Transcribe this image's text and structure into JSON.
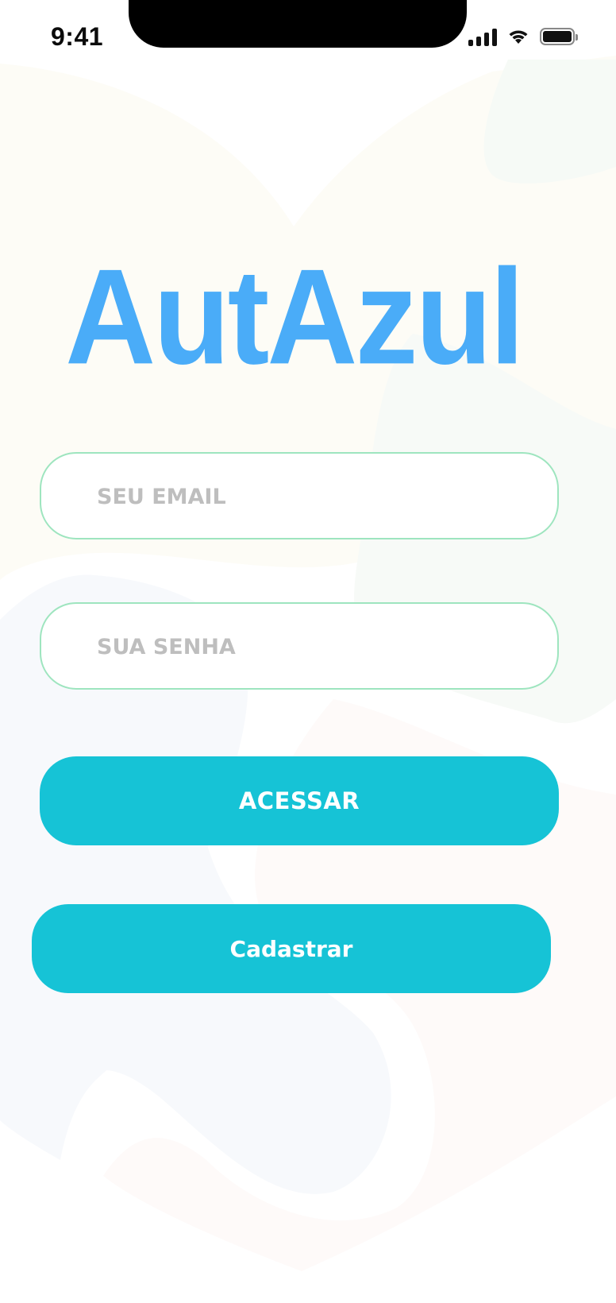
{
  "status_bar": {
    "time": "9:41",
    "icons": [
      "cellular-signal-icon",
      "wifi-icon",
      "battery-icon"
    ]
  },
  "app": {
    "logo_text": "AutAzul",
    "brand_color": "#4AACF8",
    "accent_color": "#16C3D6",
    "field_border_color": "#9EE5BF"
  },
  "login_form": {
    "email_placeholder": "SEU EMAIL",
    "email_value": "",
    "password_placeholder": "SUA SENHA",
    "password_value": "",
    "access_button_label": "ACESSAR",
    "register_button_label": "Cadastrar"
  }
}
